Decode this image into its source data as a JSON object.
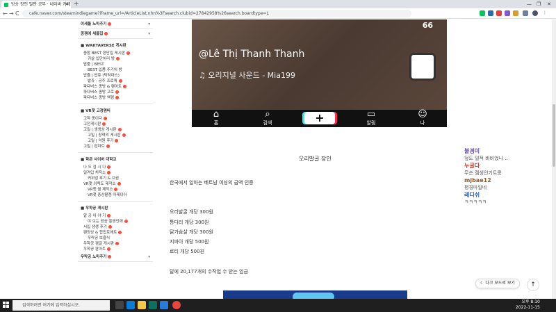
{
  "browser": {
    "tab_title": "방송 장인 발판 공부 · 네이버 카페",
    "url": "cafe.naver.com/steamindiegame?iframe_url=/ArticleList.nhn%3Fsearch.clubid=27842958%26search.boardtype=L",
    "new_tab": "+",
    "back": "←",
    "forward": "→",
    "reload": "C"
  },
  "sidebar": {
    "top_items": [
      {
        "label": "이세돌 노마추기"
      },
      {
        "label": "종겜에 세울집"
      }
    ],
    "sections": [
      {
        "title": "WAKTAVERSE 게시판",
        "items": [
          {
            "label": "종합 BEST 판단일 게시판",
            "level": 1
          },
          {
            "label": "귀살 입단처리 방",
            "level": 2
          },
          {
            "label": "밥줌 | BEST",
            "level": 1
          },
          {
            "label": "BEST 입쯤 주기위 방",
            "level": 2
          },
          {
            "label": "밥쥴 | 밥쥬 (탁락마스)",
            "level": 1
          },
          {
            "label": "밥쥬 - 공주 프로쿼",
            "level": 2
          },
          {
            "label": "파다버스 종방 & 팬아트",
            "level": 1
          },
          {
            "label": "파다버스 종방 고로",
            "level": 1
          },
          {
            "label": "파다버스 종방 액겜",
            "level": 1
          }
        ]
      },
      {
        "title": "VR챗 고정멤버",
        "items": [
          {
            "label": "고학 종이다",
            "level": 1
          },
          {
            "label": "고전게시판",
            "level": 1
          },
          {
            "label": "고밀 | 생생상 게시판",
            "level": 1
          },
          {
            "label": "고밀 | 창혁의 게시판",
            "level": 2
          },
          {
            "label": "고밀 | 악원 후기",
            "level": 2
          },
          {
            "label": "고밀 | 판마트",
            "level": 1
          }
        ]
      },
      {
        "title": "학굔 사이버 대학교",
        "items": [
          {
            "label": "나 도 검 시 다",
            "level": 1
          },
          {
            "label": "밀겨입 처작소",
            "level": 1
          },
          {
            "label": "귀위엄 후기 & 브권",
            "level": 2
          },
          {
            "label": "VR챗 이력도 제작소",
            "level": 1
          },
          {
            "label": "VR챗 월 제작소",
            "level": 2
          },
          {
            "label": "VR챗 종상활겜 아레이아",
            "level": 2
          }
        ]
      },
      {
        "title": "우학궁 게시판",
        "items": [
          {
            "label": "알 공 어 야 기",
            "level": 1
          },
          {
            "label": "야 오는 방송 홍영인애",
            "level": 2
          },
          {
            "label": "서입 생생 후기",
            "level": 1
          },
          {
            "label": "팬정상 & 합칩로애트",
            "level": 1
          },
          {
            "label": "우락공 보즐식",
            "level": 2
          },
          {
            "label": "우학공 겜글 게시판",
            "level": 1
          },
          {
            "label": "우학공 판아트",
            "level": 1
          }
        ]
      }
    ],
    "bottom_item": "우락공 노마추기"
  },
  "video": {
    "counter": "66",
    "username": "@Lê Thị Thanh Thanh",
    "sound": "오리지널 사운드 - Mia199",
    "nav": [
      {
        "label": "홈",
        "icon": "home-icon"
      },
      {
        "label": "검색",
        "icon": "search-icon"
      },
      {
        "label": "+",
        "icon": "plus-icon"
      },
      {
        "label": "알림",
        "icon": "inbox-icon"
      },
      {
        "label": "나",
        "icon": "profile-icon"
      }
    ]
  },
  "article": {
    "caption": "오리발굴 장인",
    "intro": "한국에서 일하는 베트남 여성의 급액 인증",
    "prices": [
      "오리발굴 개당 300원",
      "통다리 개당 300원",
      "닭가슴살 개당 300원",
      "지파이 개당 500원",
      "로티 개당 500원"
    ],
    "closing": "달에 20,177개의 수작업 수 받는 임금"
  },
  "chat": {
    "messages": [
      {
        "name": "불경미",
        "text": "덮도 일적 바비었나 ..",
        "color": "#6a4fb3"
      },
      {
        "name": "누굴다",
        "text": "무슨 캠생인기트릉",
        "color": "#c0392b"
      },
      {
        "name": "mjbae12",
        "text": "평경마일네",
        "color": "#8e5a2b"
      },
      {
        "name": "레디쉬",
        "text": "ㅋㅋㅋㅋㅋ",
        "color": "#2a5db0"
      }
    ]
  },
  "floating": {
    "darkmode_label": "다크 모드로 보기",
    "top_label": "↑"
  },
  "taskbar": {
    "search_placeholder": "검색하려면 여기에 입력하십시오.",
    "time": "오후 8:10",
    "date": "2022-11-15"
  }
}
